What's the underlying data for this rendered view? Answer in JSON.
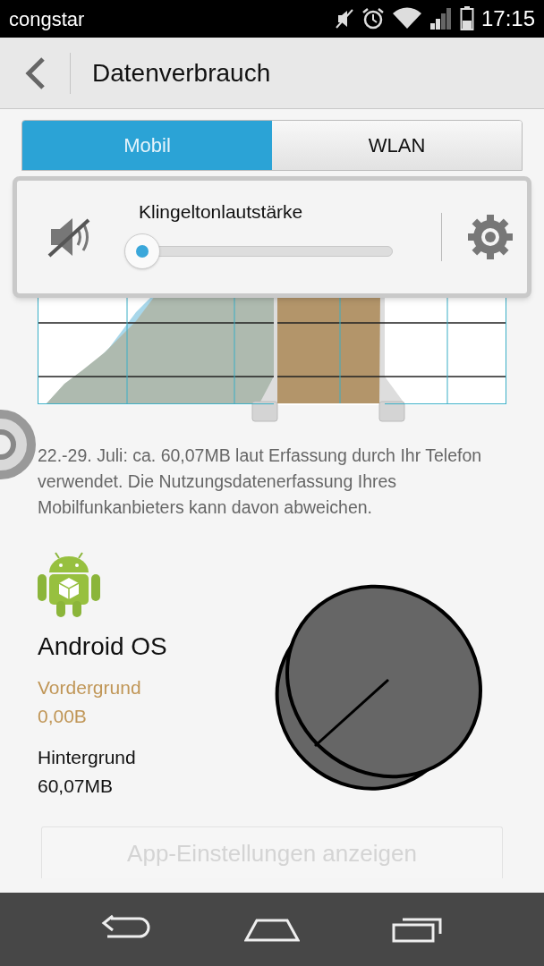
{
  "status_bar": {
    "carrier": "congstar",
    "time": "17:15"
  },
  "header": {
    "title": "Datenverbrauch"
  },
  "tabs": [
    {
      "label": "Mobil",
      "selected": true
    },
    {
      "label": "WLAN",
      "selected": false
    }
  ],
  "volume_popup": {
    "title": "Klingeltonlautstärke",
    "muted": true
  },
  "summary": "22.-29. Juli: ca. 60,07MB laut Erfassung durch Ihr Telefon verwendet. Die Nutzungsdatenerfassung Ihres Mobilfunkanbieters kann davon abweichen.",
  "app": {
    "name": "Android OS",
    "foreground_label": "Vordergrund",
    "foreground_value": "0,00B",
    "background_label": "Hintergrund",
    "background_value": "60,07MB"
  },
  "settings_button": {
    "label": "App-Einstellungen anzeigen",
    "disabled": true
  }
}
